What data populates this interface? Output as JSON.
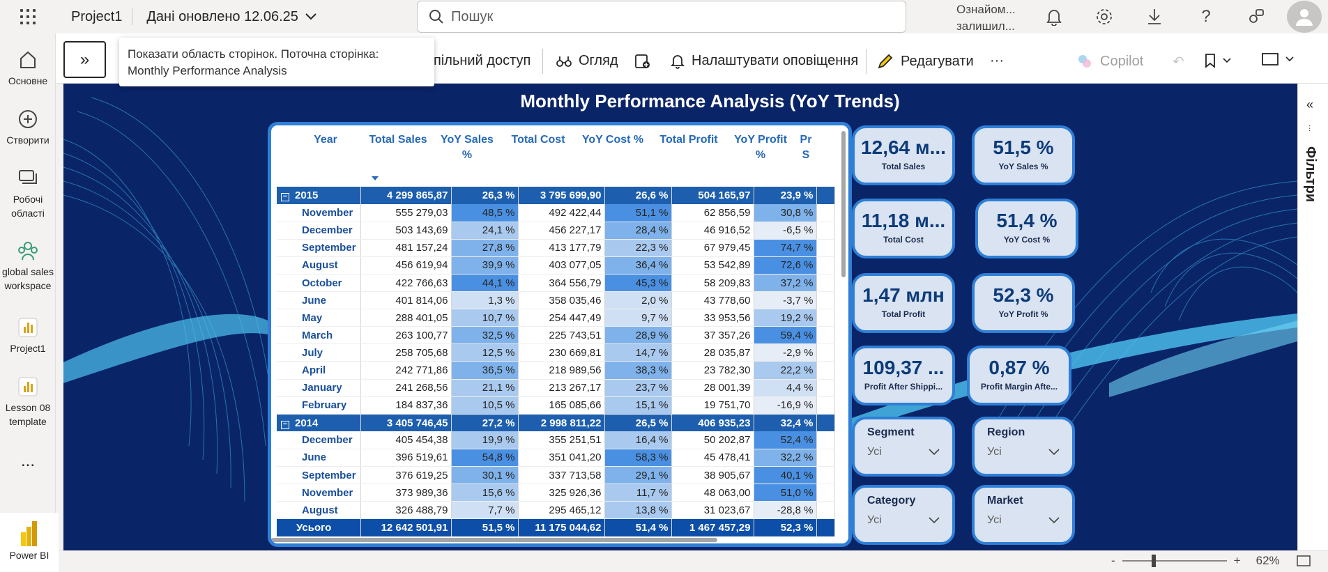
{
  "topbar": {
    "app_name": "Project1",
    "refresh_text": "Дані оновлено 12.06.25",
    "search_placeholder": "Пошук",
    "trial_line1": "Ознайом...",
    "trial_line2": "залишил..."
  },
  "leftnav": {
    "items": [
      {
        "label": "Основне",
        "icon": "home-icon"
      },
      {
        "label": "Створити",
        "icon": "plus-circle-icon"
      },
      {
        "label": "Робочі області",
        "icon": "workspaces-icon"
      },
      {
        "label": "global sales workspace",
        "icon": "people-icon"
      },
      {
        "label": "Project1",
        "icon": "report-icon"
      },
      {
        "label": "Lesson 08 template",
        "icon": "report-icon"
      },
      {
        "label": "...",
        "icon": "more-icon"
      }
    ],
    "brand": "Power BI"
  },
  "toolbar": {
    "share": "спільний доступ",
    "review": "Огляд",
    "alerts": "Налаштувати оповіщення",
    "edit": "Редагувати",
    "more": "···",
    "copilot": "Copilot"
  },
  "tooltip": {
    "line1": "Показати область сторінок. Поточна сторінка:",
    "line2": "Monthly Performance Analysis"
  },
  "report": {
    "title": "Monthly Performance Analysis (YoY Trends)"
  },
  "table": {
    "headers": [
      "Year",
      "Total Sales",
      "YoY Sales %",
      "Total Cost",
      "YoY Cost %",
      "Total Profit",
      "YoY Profit %",
      "Pr S"
    ],
    "rows": [
      {
        "type": "year",
        "label": "2015",
        "cells": [
          "4 299 865,87",
          "26,3 %",
          "3 795 699,90",
          "26,6 %",
          "504 165,97",
          "23,9 %"
        ]
      },
      {
        "type": "month",
        "label": "November",
        "cells": [
          "555 279,03",
          "48,5 %",
          "492 422,44",
          "51,1 %",
          "62 856,59",
          "30,8 %"
        ]
      },
      {
        "type": "month",
        "label": "December",
        "cells": [
          "503 143,69",
          "24,1 %",
          "456 227,17",
          "28,4 %",
          "46 916,52",
          "-6,5 %"
        ]
      },
      {
        "type": "month",
        "label": "September",
        "cells": [
          "481 157,24",
          "27,8 %",
          "413 177,79",
          "22,3 %",
          "67 979,45",
          "74,7 %"
        ]
      },
      {
        "type": "month",
        "label": "August",
        "cells": [
          "456 619,94",
          "39,9 %",
          "403 077,05",
          "36,4 %",
          "53 542,89",
          "72,6 %"
        ]
      },
      {
        "type": "month",
        "label": "October",
        "cells": [
          "422 766,63",
          "44,1 %",
          "364 556,79",
          "45,3 %",
          "58 209,83",
          "37,2 %"
        ]
      },
      {
        "type": "month",
        "label": "June",
        "cells": [
          "401 814,06",
          "1,3 %",
          "358 035,46",
          "2,0 %",
          "43 778,60",
          "-3,7 %"
        ]
      },
      {
        "type": "month",
        "label": "May",
        "cells": [
          "288 401,05",
          "10,7 %",
          "254 447,49",
          "9,7 %",
          "33 953,56",
          "19,2 %"
        ]
      },
      {
        "type": "month",
        "label": "March",
        "cells": [
          "263 100,77",
          "32,5 %",
          "225 743,51",
          "28,9 %",
          "37 357,26",
          "59,4 %"
        ]
      },
      {
        "type": "month",
        "label": "July",
        "cells": [
          "258 705,68",
          "12,5 %",
          "230 669,81",
          "14,7 %",
          "28 035,87",
          "-2,9 %"
        ]
      },
      {
        "type": "month",
        "label": "April",
        "cells": [
          "242 771,86",
          "36,5 %",
          "218 989,56",
          "38,3 %",
          "23 782,30",
          "22,2 %"
        ]
      },
      {
        "type": "month",
        "label": "January",
        "cells": [
          "241 268,56",
          "21,1 %",
          "213 267,17",
          "23,7 %",
          "28 001,39",
          "4,4 %"
        ]
      },
      {
        "type": "month",
        "label": "February",
        "cells": [
          "184 837,36",
          "10,5 %",
          "165 085,66",
          "15,1 %",
          "19 751,70",
          "-16,9 %"
        ]
      },
      {
        "type": "year",
        "label": "2014",
        "cells": [
          "3 405 746,45",
          "27,2 %",
          "2 998 811,22",
          "26,5 %",
          "406 935,23",
          "32,4 %"
        ]
      },
      {
        "type": "month",
        "label": "December",
        "cells": [
          "405 454,38",
          "19,9 %",
          "355 251,51",
          "16,4 %",
          "50 202,87",
          "52,4 %"
        ]
      },
      {
        "type": "month",
        "label": "June",
        "cells": [
          "396 519,61",
          "54,8 %",
          "351 041,20",
          "58,3 %",
          "45 478,41",
          "32,2 %"
        ]
      },
      {
        "type": "month",
        "label": "September",
        "cells": [
          "376 619,25",
          "30,1 %",
          "337 713,58",
          "29,1 %",
          "38 905,67",
          "40,1 %"
        ]
      },
      {
        "type": "month",
        "label": "November",
        "cells": [
          "373 989,36",
          "15,6 %",
          "325 926,36",
          "11,7 %",
          "48 063,00",
          "51,0 %"
        ]
      },
      {
        "type": "month",
        "label": "August",
        "cells": [
          "326 488,79",
          "7,7 %",
          "295 465,12",
          "13,8 %",
          "31 023,67",
          "-28,8 %"
        ]
      }
    ],
    "total": {
      "label": "Усього",
      "cells": [
        "12 642 501,91",
        "51,5 %",
        "11 175 044,62",
        "51,4 %",
        "1 467 457,29",
        "52,3 %"
      ]
    }
  },
  "kpis": [
    {
      "value": "12,64 м...",
      "label": "Total Sales"
    },
    {
      "value": "51,5 %",
      "label": "YoY Sales %"
    },
    {
      "value": "11,18 м...",
      "label": "Total Cost"
    },
    {
      "value": "51,4 %",
      "label": "YoY Cost %"
    },
    {
      "value": "1,47 млн",
      "label": "Total Profit"
    },
    {
      "value": "52,3 %",
      "label": "YoY Profit %"
    },
    {
      "value": "109,37 ...",
      "label": "Profit After Shippi..."
    },
    {
      "value": "0,87 %",
      "label": "Profit Margin Afte..."
    }
  ],
  "slicers": [
    {
      "title": "Segment",
      "value": "Усі"
    },
    {
      "title": "Region",
      "value": "Усі"
    },
    {
      "title": "Category",
      "value": "Усі"
    },
    {
      "title": "Market",
      "value": "Усі"
    }
  ],
  "filters_pane": {
    "label": "Фільтри"
  },
  "zoom": {
    "minus": "-",
    "plus": "+",
    "level": "62%"
  },
  "colors": {
    "canvas": "#0a2468",
    "accent": "#2f7fd6",
    "header_text": "#2669b8",
    "year_row": "#1d5fae",
    "highlight_strong": "#4a90e2",
    "highlight_light": "#a9c9ee"
  }
}
